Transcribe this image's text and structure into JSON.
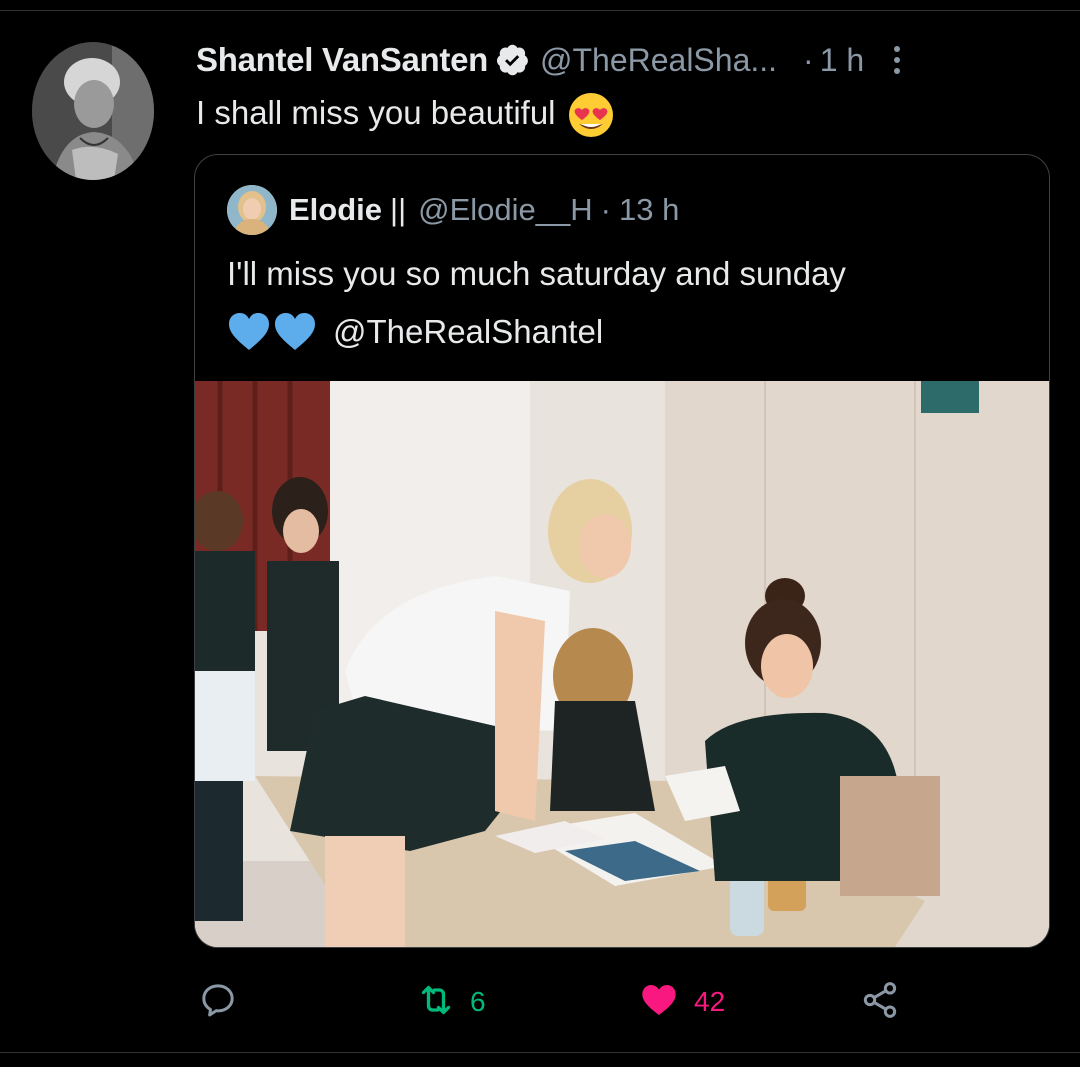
{
  "tweet": {
    "author_name": "Shantel VanSanten",
    "author_handle": "@TheRealSha...",
    "dot": "·",
    "time": "1 h",
    "text": "I shall miss you beautiful"
  },
  "quote": {
    "author_name": "Elodie",
    "separator": "||",
    "author_handle": "@Elodie__H",
    "dot": "·",
    "time": "13 h",
    "text_line1": "I'll miss you so much saturday and sunday",
    "mention": "@TheRealShantel"
  },
  "actions": {
    "retweet_count": "6",
    "like_count": "42"
  },
  "colors": {
    "background": "#000000",
    "text_primary": "#e7e9ea",
    "text_secondary": "#8b98a5",
    "verified_badge": "#e7e9ea",
    "retweet_green": "#00ba7c",
    "like_pink": "#f91880",
    "heart_blue": "#5dadec"
  },
  "icons": [
    "verified-icon",
    "more-icon",
    "heart-eyes-emoji",
    "blue-heart-emoji",
    "reply-icon",
    "retweet-icon",
    "like-icon",
    "share-icon"
  ]
}
